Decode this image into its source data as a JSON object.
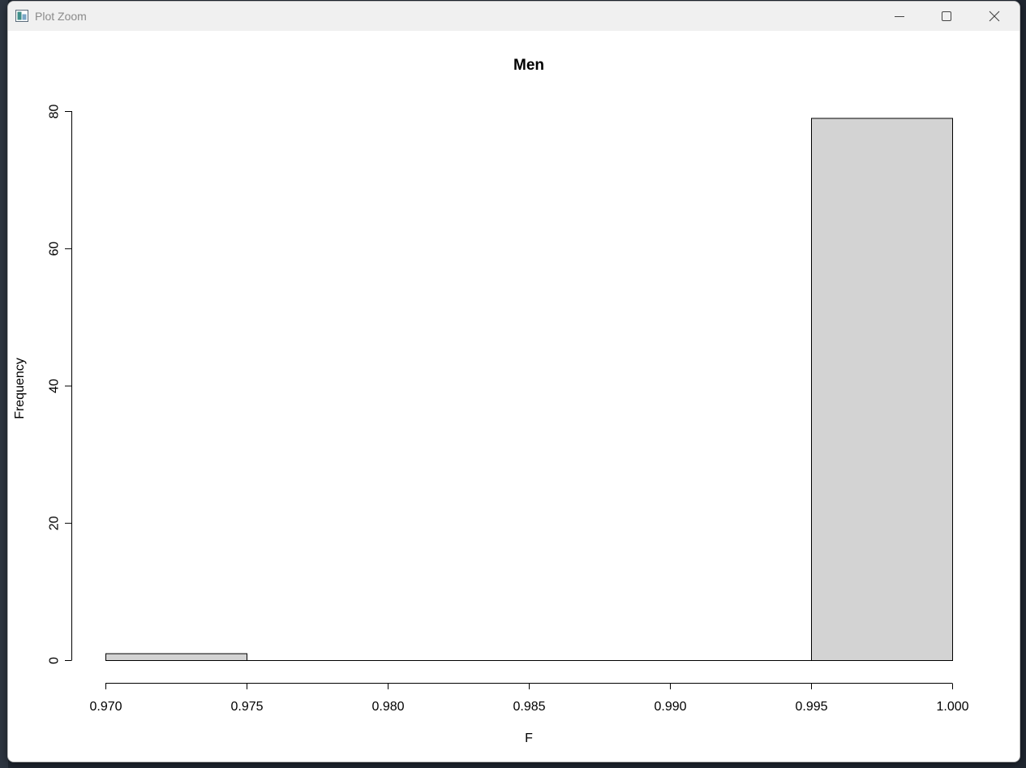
{
  "window": {
    "title": "Plot Zoom"
  },
  "icons": {
    "app": "plot-zoom-icon",
    "minimize": "minimize-icon",
    "maximize": "maximize-icon",
    "close": "close-icon"
  },
  "colors": {
    "bar_fill": "#d3d3d3",
    "bar_stroke": "#000000",
    "titlebar": "#f0f0f0"
  },
  "chart_data": {
    "type": "bar",
    "title": "Men",
    "xlabel": "F",
    "ylabel": "Frequency",
    "bins": [
      {
        "start": 0.97,
        "end": 0.975,
        "count": 1
      },
      {
        "start": 0.975,
        "end": 0.98,
        "count": 0
      },
      {
        "start": 0.98,
        "end": 0.985,
        "count": 0
      },
      {
        "start": 0.985,
        "end": 0.99,
        "count": 0
      },
      {
        "start": 0.99,
        "end": 0.995,
        "count": 0
      },
      {
        "start": 0.995,
        "end": 1.0,
        "count": 79
      }
    ],
    "xlim": [
      0.97,
      1.0
    ],
    "ylim": [
      0,
      80
    ],
    "x_ticks": [
      {
        "value": 0.97,
        "label": "0.970"
      },
      {
        "value": 0.975,
        "label": "0.975"
      },
      {
        "value": 0.98,
        "label": "0.980"
      },
      {
        "value": 0.985,
        "label": "0.985"
      },
      {
        "value": 0.99,
        "label": "0.990"
      },
      {
        "value": 0.995,
        "label": "0.995"
      },
      {
        "value": 1.0,
        "label": "1.000"
      }
    ],
    "y_ticks": [
      {
        "value": 0,
        "label": "0"
      },
      {
        "value": 20,
        "label": "20"
      },
      {
        "value": 40,
        "label": "40"
      },
      {
        "value": 60,
        "label": "60"
      },
      {
        "value": 80,
        "label": "80"
      }
    ],
    "grid": false
  }
}
